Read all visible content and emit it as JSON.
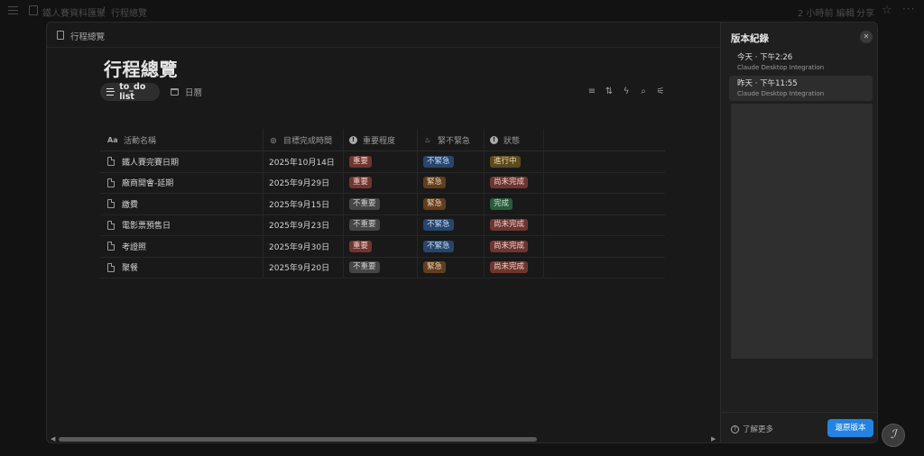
{
  "topbar": {
    "breadcrumb_1": "鐵人賽資料匯聚",
    "breadcrumb_sep": "/",
    "breadcrumb_2": "行程總覽",
    "edited": "2 小時前 編輯",
    "share": "分享"
  },
  "modal": {
    "header_title": "行程總覽",
    "page_title": "行程總覽",
    "views": [
      {
        "label": "to_do list",
        "active": true
      },
      {
        "label": "日曆",
        "active": false
      }
    ],
    "toolbar_icons": [
      "filter-icon",
      "sort-icon",
      "lightning-icon",
      "search-icon",
      "settings-icon"
    ]
  },
  "table": {
    "columns": [
      "活動名稱",
      "目標完成時間",
      "重要程度",
      "緊不緊急",
      "狀態"
    ],
    "rows": [
      {
        "name": "鐵人賽完賽日期",
        "date": "2025年10月14日",
        "importance": "重要",
        "urgency": "不緊急",
        "status": "進行中"
      },
      {
        "name": "廠商開會-延期",
        "date": "2025年9月29日",
        "importance": "重要",
        "urgency": "緊急",
        "status": "尚未完成"
      },
      {
        "name": "繳費",
        "date": "2025年9月15日",
        "importance": "不重要",
        "urgency": "緊急",
        "status": "完成"
      },
      {
        "name": "電影票預售日",
        "date": "2025年9月23日",
        "importance": "不重要",
        "urgency": "不緊急",
        "status": "尚未完成"
      },
      {
        "name": "考證照",
        "date": "2025年9月30日",
        "importance": "重要",
        "urgency": "不緊急",
        "status": "尚未完成"
      },
      {
        "name": "聚餐",
        "date": "2025年9月20日",
        "importance": "不重要",
        "urgency": "緊急",
        "status": "尚未完成"
      }
    ]
  },
  "tag_colors": {
    "重要": "#6e3630",
    "不重要": "#454545",
    "緊急": "#603e1f",
    "不緊急": "#28456c",
    "進行中": "#5a4a1d",
    "尚未完成": "#6e3630",
    "完成": "#2b5a3d"
  },
  "panel": {
    "title": "版本紀錄",
    "versions": [
      {
        "time": "今天 · 下午2:26",
        "source": "Claude Desktop Integration"
      },
      {
        "time": "昨天 · 下午11:55",
        "source": "Claude Desktop Integration"
      }
    ],
    "learn_more": "了解更多",
    "restore": "還原版本"
  },
  "accent_color": "#2383e2"
}
